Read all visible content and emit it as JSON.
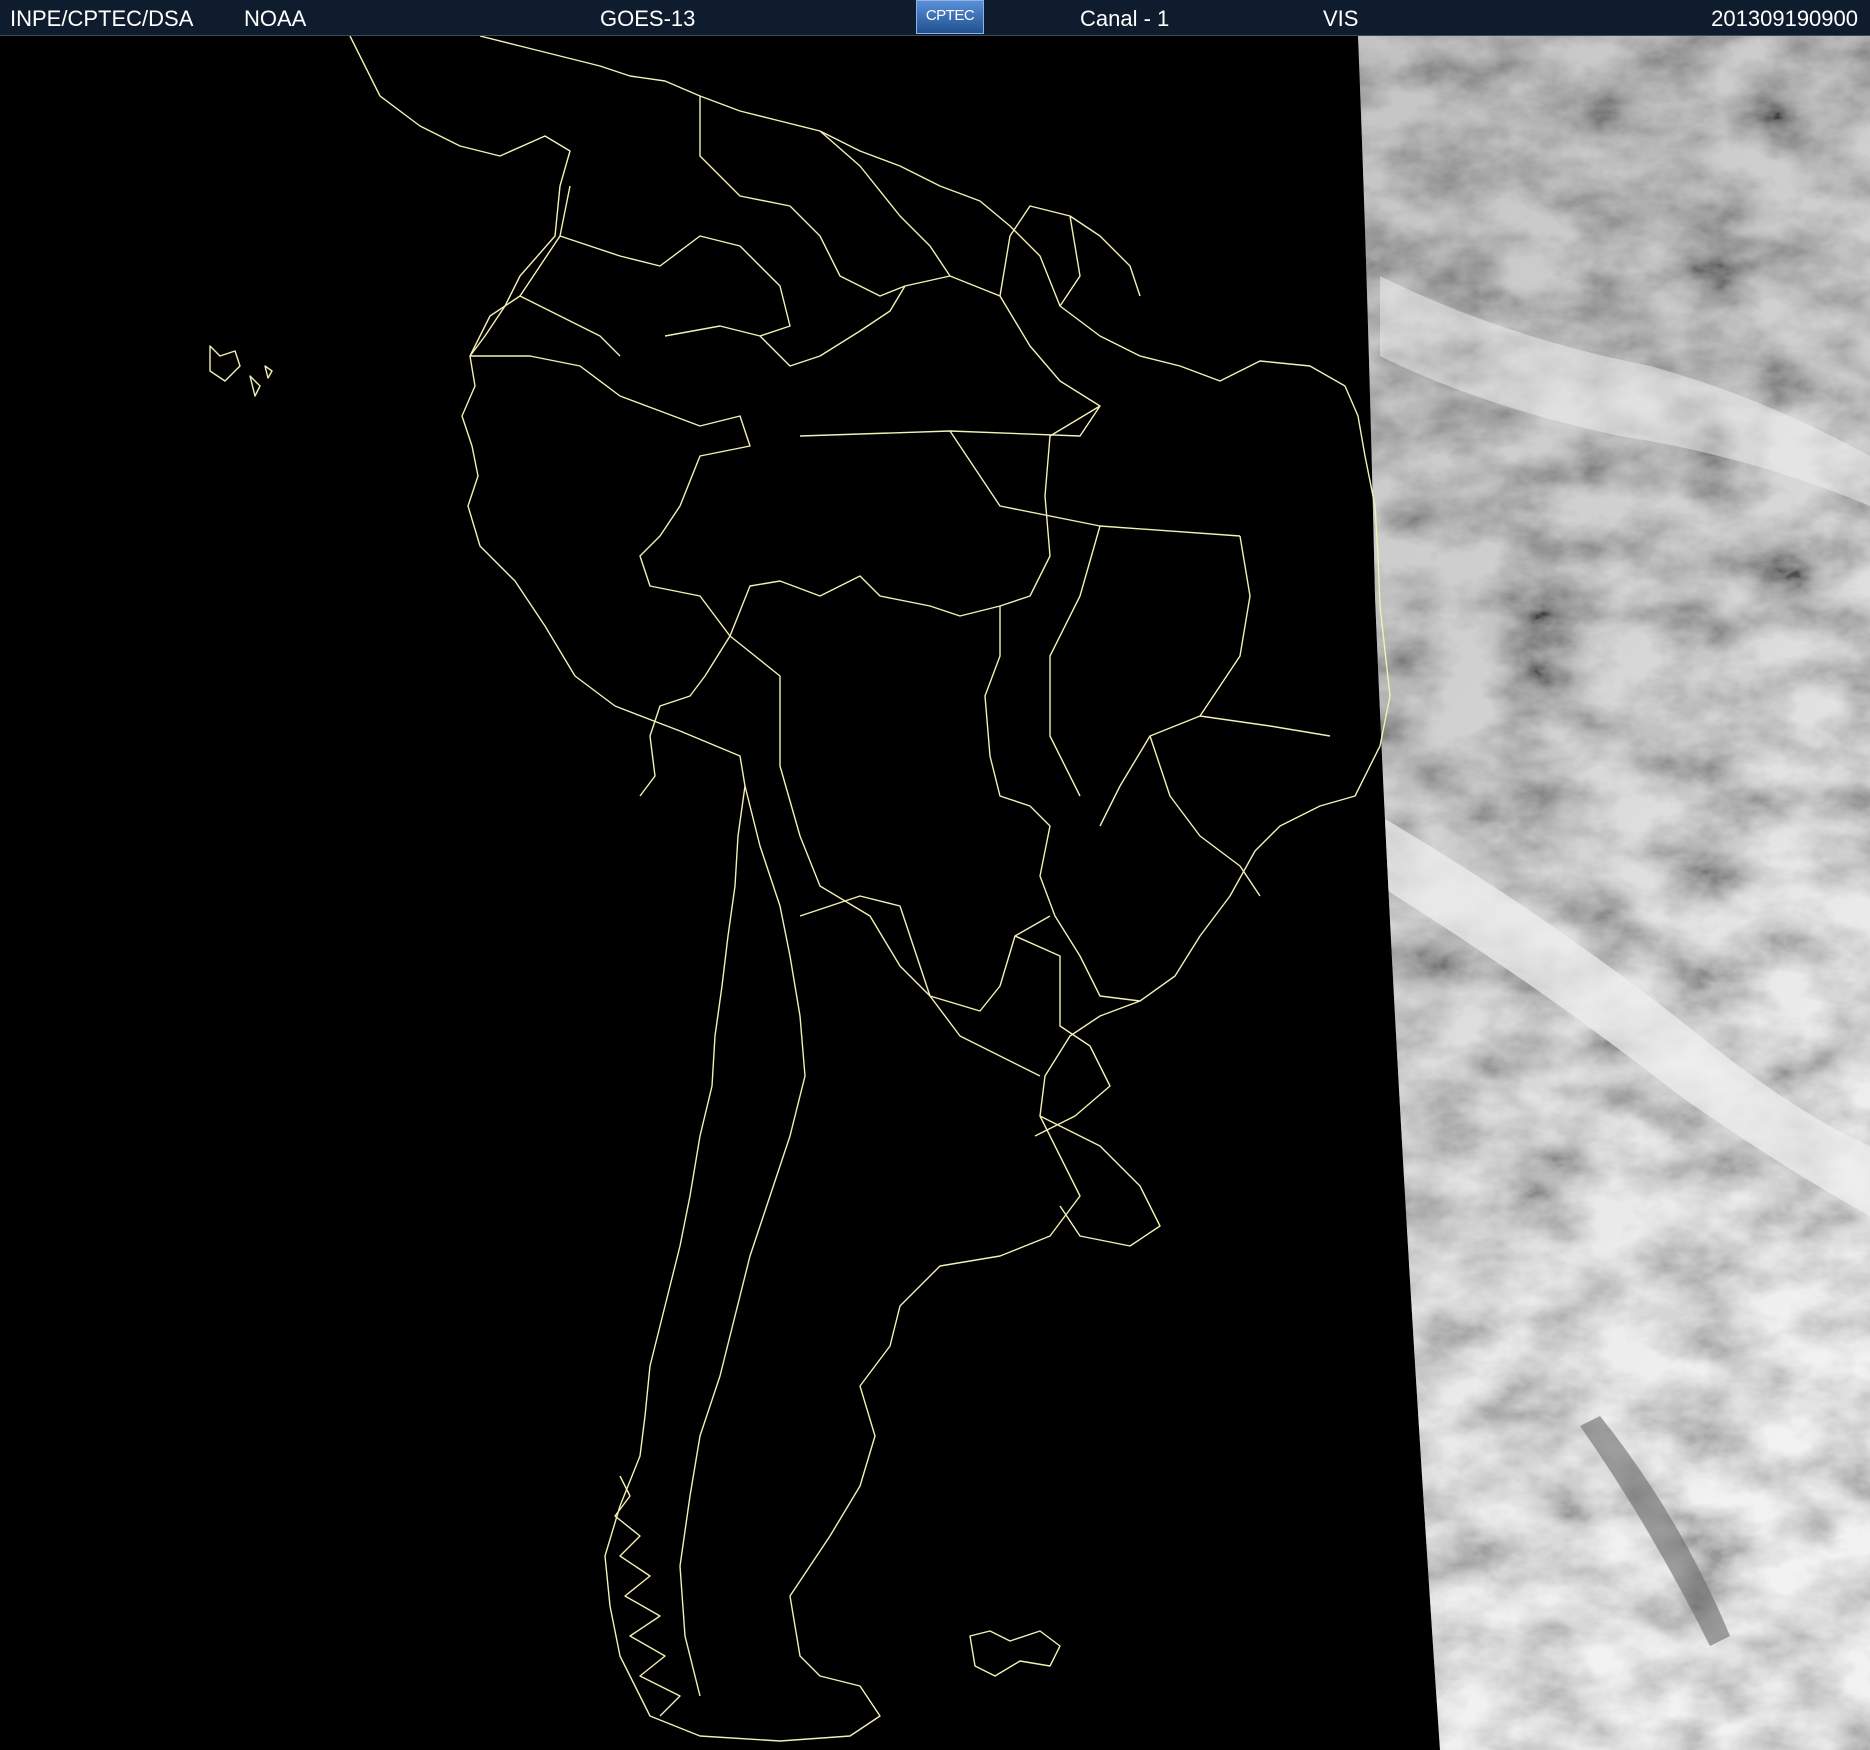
{
  "header": {
    "agency": "INPE/CPTEC/DSA",
    "provider": "NOAA",
    "satellite": "GOES-13",
    "logo_text": "CPTEC",
    "channel": "Canal - 1",
    "band": "VIS",
    "timestamp": "201309190900"
  },
  "map": {
    "region": "South America",
    "imagery": "visible channel cloud field",
    "boundary_color": "#f2f0b5",
    "background_color": "#000000",
    "header_color": "#0f1c2e"
  }
}
